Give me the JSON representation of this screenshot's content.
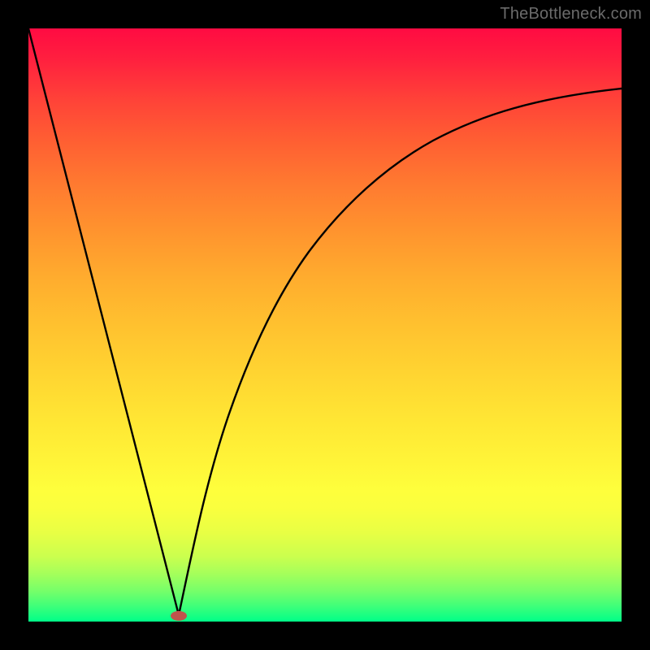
{
  "attribution": "TheBottleneck.com",
  "colors": {
    "frame": "#000000",
    "curve_stroke": "#000000",
    "marker_fill": "#c0544c",
    "gradient_top": "#ff0b42",
    "gradient_bottom": "#00ff88"
  },
  "chart_data": {
    "type": "line",
    "title": "",
    "xlabel": "",
    "ylabel": "",
    "xlim": [
      0,
      100
    ],
    "ylim": [
      0,
      100
    ],
    "marker": {
      "x": 25,
      "y": 1
    },
    "series": [
      {
        "name": "left-branch",
        "x": [
          0,
          5,
          10,
          15,
          20,
          25
        ],
        "values": [
          100,
          80,
          60,
          40,
          20,
          1
        ]
      },
      {
        "name": "right-branch",
        "x": [
          25,
          27,
          29,
          32,
          35,
          38,
          42,
          46,
          50,
          55,
          60,
          65,
          70,
          75,
          80,
          85,
          90,
          95,
          100
        ],
        "values": [
          1,
          11,
          20,
          30,
          38,
          45,
          52,
          58,
          63,
          68,
          72,
          75.5,
          78.5,
          81,
          83,
          85,
          86.7,
          88.2,
          89.5
        ]
      }
    ],
    "annotations": []
  }
}
